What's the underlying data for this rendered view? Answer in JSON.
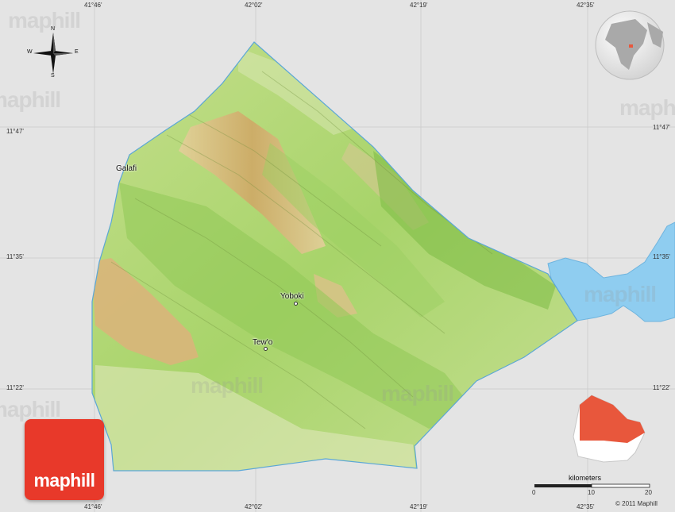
{
  "map": {
    "coords": {
      "top": [
        "41°46'",
        "42°02'",
        "42°19'",
        "42°35'"
      ],
      "bottom": [
        "41°46'",
        "42°02'",
        "42°19'",
        "42°35'"
      ],
      "left": [
        "11°47'",
        "11°35'",
        "11°22'"
      ],
      "right": [
        "11°47'",
        "11°35'",
        "11°22'"
      ]
    },
    "places": [
      "Galafi",
      "Yoboki",
      "Tew'o"
    ],
    "watermark": "maphill",
    "logo_text": "maphill",
    "compass": {
      "n": "N",
      "s": "S",
      "e": "E",
      "w": "W"
    },
    "scale": {
      "unit": "kilometers",
      "ticks": [
        "0",
        "10",
        "20"
      ]
    },
    "copyright": "© 2011 Maphill",
    "colors": {
      "lowland": "#b8d974",
      "highland": "#d7b57a",
      "water": "#8fcdf0",
      "logo": "#e8392a",
      "highlight": "#e8573c"
    }
  }
}
